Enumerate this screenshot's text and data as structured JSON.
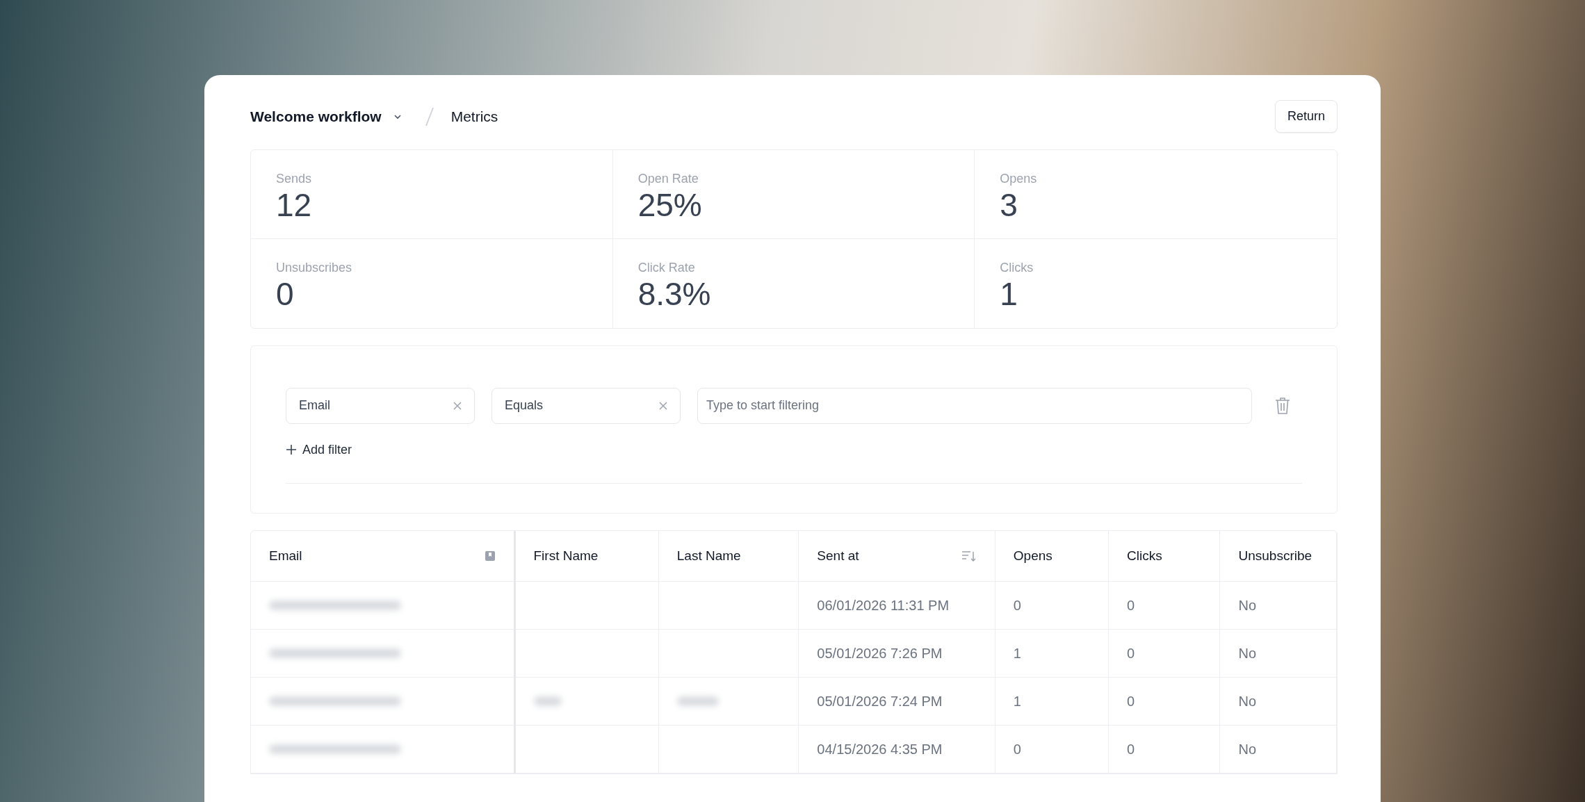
{
  "breadcrumb": {
    "workflow": "Welcome workflow",
    "page": "Metrics"
  },
  "return_button": "Return",
  "stats": [
    {
      "label": "Sends",
      "value": "12"
    },
    {
      "label": "Open Rate",
      "value": "25%"
    },
    {
      "label": "Opens",
      "value": "3"
    },
    {
      "label": "Unsubscribes",
      "value": "0"
    },
    {
      "label": "Click Rate",
      "value": "8.3%"
    },
    {
      "label": "Clicks",
      "value": "1"
    }
  ],
  "filter": {
    "field": "Email",
    "operator": "Equals",
    "placeholder": "Type to start filtering",
    "add_label": "Add filter"
  },
  "table": {
    "columns": [
      "Email",
      "First Name",
      "Last Name",
      "Sent at",
      "Opens",
      "Clicks",
      "Unsubscribe"
    ],
    "rows": [
      {
        "email_redacted": true,
        "name_redacted": false,
        "sent_at": "06/01/2026 11:31 PM",
        "opens": "0",
        "clicks": "0",
        "unsubscribed": "No"
      },
      {
        "email_redacted": true,
        "name_redacted": false,
        "sent_at": "05/01/2026 7:26 PM",
        "opens": "1",
        "clicks": "0",
        "unsubscribed": "No"
      },
      {
        "email_redacted": true,
        "name_redacted": true,
        "sent_at": "05/01/2026 7:24 PM",
        "opens": "1",
        "clicks": "0",
        "unsubscribed": "No"
      },
      {
        "email_redacted": true,
        "name_redacted": false,
        "sent_at": "04/15/2026 4:35 PM",
        "opens": "0",
        "clicks": "0",
        "unsubscribed": "No"
      }
    ]
  }
}
